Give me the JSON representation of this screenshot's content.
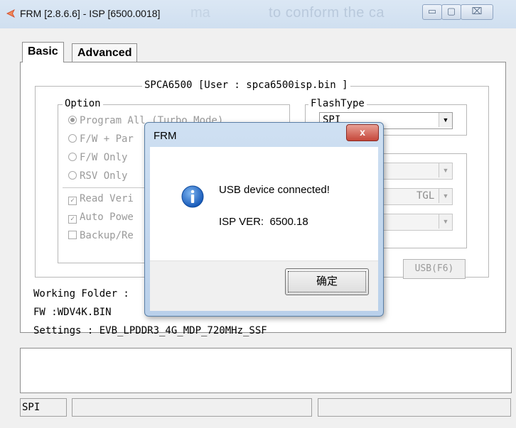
{
  "window": {
    "title": "FRM [2.8.6.6] - ISP [6500.0018]",
    "ghost_text_a": "ma",
    "ghost_text_b": "to conform the ca",
    "buttons": {
      "minimize": "▭",
      "maximize": "▢",
      "close": "⌧"
    }
  },
  "tabs": [
    {
      "label": "Basic"
    },
    {
      "label": "Advanced"
    }
  ],
  "device_group": {
    "label": "SPCA6500 [User : spca6500isp.bin ]"
  },
  "option_group": {
    "label": "Option",
    "radios": [
      {
        "label": "Program All (Turbo Mode)",
        "selected": true
      },
      {
        "label": "F/W + Par"
      },
      {
        "label": "F/W Only"
      },
      {
        "label": "RSV Only"
      }
    ],
    "checks": [
      {
        "label": "Read Veri",
        "checked": true
      },
      {
        "label": "Auto Powe",
        "checked": true
      },
      {
        "label": "Backup/Re",
        "checked": false
      }
    ],
    "check_mark": "✓"
  },
  "flash_group": {
    "label": "FlashType",
    "combo_value": "SPI",
    "combo2_value": "",
    "combo3_value": "TGL",
    "combo4_value": "",
    "arrow": "▼"
  },
  "usb_button": "USB(F6)",
  "info": {
    "working_folder": "Working Folder :",
    "fw": "FW :WDV4K.BIN",
    "settings": "Settings : EVB_LPDDR3_4G_MDP_720MHz_SSF"
  },
  "status_bar": {
    "panel1": "SPI",
    "panel2": "",
    "panel3": ""
  },
  "dialog": {
    "title": "FRM",
    "close": "x",
    "message": "USB device connected!",
    "isp_ver_label": "ISP VER:",
    "isp_ver_value": "6500.18",
    "ok_button": "确定",
    "icon": "info-icon"
  }
}
